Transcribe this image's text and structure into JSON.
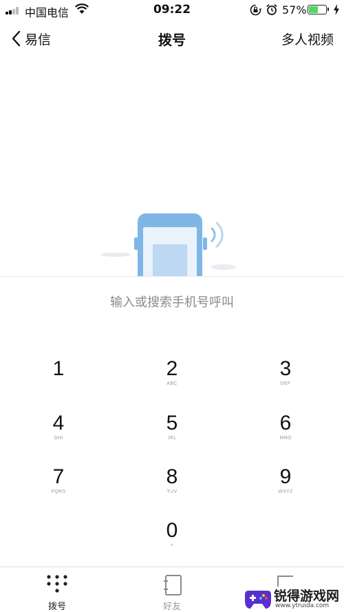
{
  "status_bar": {
    "carrier": "中国电信",
    "time": "09:22",
    "battery_percent": "57%",
    "battery_level": 0.57,
    "icons": [
      "signal-icon",
      "wifi-icon",
      "rotation-lock-icon",
      "alarm-icon",
      "battery-icon",
      "charging-icon"
    ]
  },
  "nav": {
    "back_label": "易信",
    "title": "拨号",
    "right_label": "多人视频"
  },
  "dial": {
    "placeholder": "输入或搜索手机号呼叫",
    "value": "",
    "keys": [
      {
        "digit": "1",
        "letters": ""
      },
      {
        "digit": "2",
        "letters": "ABC"
      },
      {
        "digit": "3",
        "letters": "DEF"
      },
      {
        "digit": "4",
        "letters": "GHI"
      },
      {
        "digit": "5",
        "letters": "JKL"
      },
      {
        "digit": "6",
        "letters": "MNO"
      },
      {
        "digit": "7",
        "letters": "PQRS"
      },
      {
        "digit": "8",
        "letters": "TUV"
      },
      {
        "digit": "9",
        "letters": "WXYZ"
      },
      {
        "digit": "0",
        "letters": "+"
      }
    ]
  },
  "tabs": [
    {
      "label": "拨号",
      "icon": "dialpad-icon",
      "active": true
    },
    {
      "label": "好友",
      "icon": "contacts-icon",
      "active": false
    }
  ],
  "watermark": {
    "title": "锐得游戏网",
    "url": "www.ytruida.com"
  },
  "colors": {
    "battery_fill": "#4cd964",
    "illustration_blue": "#7fb6e6",
    "placeholder_gray": "#8a8a8a"
  }
}
